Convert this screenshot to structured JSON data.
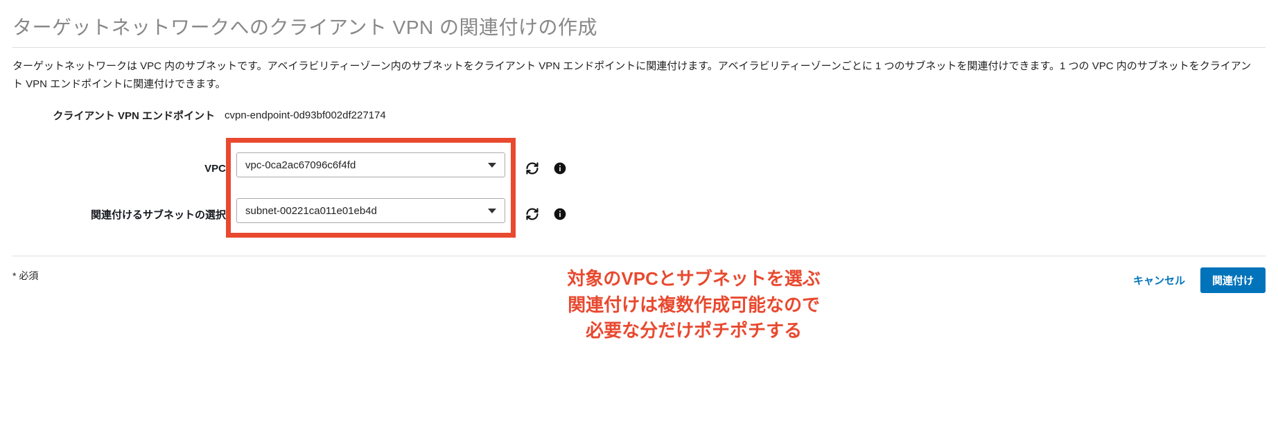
{
  "page": {
    "title": "ターゲットネットワークへのクライアント VPN の関連付けの作成",
    "description": "ターゲットネットワークは VPC 内のサブネットです。アベイラビリティーゾーン内のサブネットをクライアント VPN エンドポイントに関連付けます。アベイラビリティーゾーンごとに 1 つのサブネットを関連付けできます。1 つの VPC 内のサブネットをクライアント VPN エンドポイントに関連付けできます。"
  },
  "form": {
    "endpoint_label": "クライアント VPN エンドポイント",
    "endpoint_value": "cvpn-endpoint-0d93bf002df227174",
    "vpc_label": "VPC",
    "vpc_value": "vpc-0ca2ac67096c6f4fd",
    "subnet_label": "関連付けるサブネットの選択",
    "subnet_value": "subnet-00221ca011e01eb4d"
  },
  "footer": {
    "required_note": "* 必須",
    "cancel_label": "キャンセル",
    "submit_label": "関連付け"
  },
  "annotation": {
    "line1": "対象のVPCとサブネットを選ぶ",
    "line2": "関連付けは複数作成可能なので",
    "line3": "必要な分だけポチポチする"
  }
}
